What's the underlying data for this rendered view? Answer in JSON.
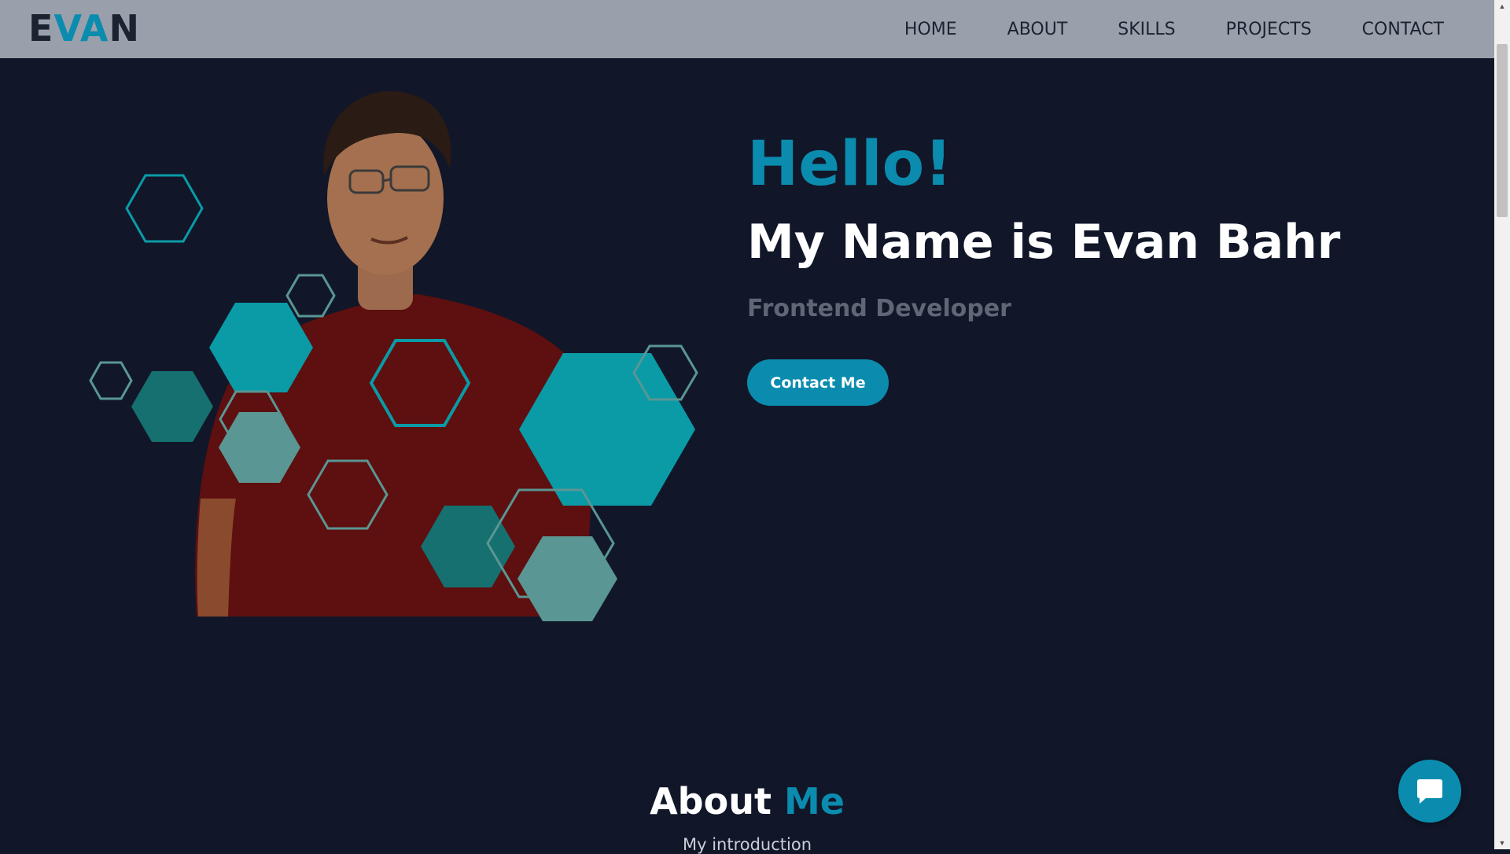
{
  "navbar": {
    "logo_prefix": "E",
    "logo_accent": "VA",
    "logo_suffix": "N",
    "links": [
      "HOME",
      "ABOUT",
      "SKILLS",
      "PROJECTS",
      "CONTACT"
    ]
  },
  "hero": {
    "greeting": "Hello!",
    "name_heading": "My Name is Evan Bahr",
    "role": "Frontend Developer",
    "contact_button": "Contact Me"
  },
  "about": {
    "title_white": "About",
    "title_accent": "Me",
    "subtitle": "My introduction"
  },
  "icons": {
    "chat": "chat-bubble-icon",
    "scroll_up": "scroll-up-arrow-icon",
    "scroll_down": "scroll-down-arrow-icon"
  },
  "colors": {
    "background": "#111729",
    "navbar": "#9aa0ab",
    "accent": "#0b8cae",
    "muted": "#5f6776",
    "hex_fill_primary": "#0a9ba7",
    "hex_fill_dark": "#15706f",
    "hex_fill_light": "#5a9693",
    "shirt": "#5e0f0f"
  }
}
